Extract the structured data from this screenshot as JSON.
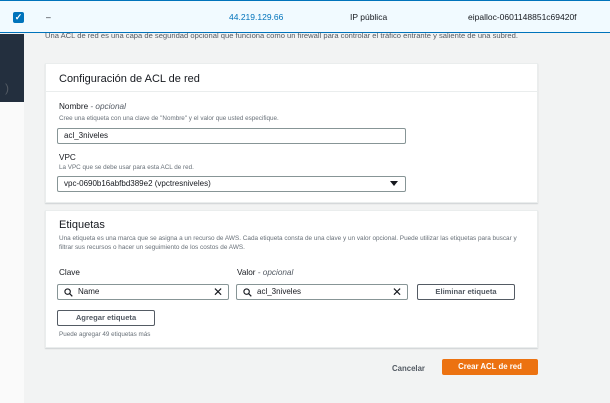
{
  "table_row": {
    "selected": true,
    "name": "–",
    "ip": "44.219.129.66",
    "ip_type": "IP pública",
    "allocation_id": "eipalloc-0601148851c69420f"
  },
  "description": "Una ACL de red es una capa de seguridad opcional que funciona como un firewall para controlar el tráfico entrante y saliente de una subred.",
  "acl_config": {
    "title": "Configuración de ACL de red",
    "name_label": "Nombre",
    "optional": "- opcional",
    "name_hint": "Cree una etiqueta con una clave de \"Nombre\" y el valor que usted especifique.",
    "name_value": "acl_3niveles",
    "vpc_label": "VPC",
    "vpc_hint": "La VPC que se debe usar para esta ACL de red.",
    "vpc_value": "vpc-0690b16abfbd389e2 (vpctresniveles)"
  },
  "tags": {
    "title": "Etiquetas",
    "description": "Una etiqueta es una marca que se asigna a un recurso de AWS. Cada etiqueta consta de una clave y un valor opcional. Puede utilizar las etiquetas para buscar y filtrar sus recursos o hacer un seguimiento de los costos de AWS.",
    "key_label": "Clave",
    "value_label": "Valor",
    "value_optional": "- opcional",
    "key_value": "Name",
    "value_value": "acl_3niveles",
    "remove_button": "Eliminar etiqueta",
    "add_button": "Agregar etiqueta",
    "remaining": "Puede agregar 49 etiquetas más"
  },
  "footer": {
    "cancel": "Cancelar",
    "create": "Crear ACL de red"
  },
  "colors": {
    "accent": "#0073bb",
    "primary": "#ec7211"
  }
}
